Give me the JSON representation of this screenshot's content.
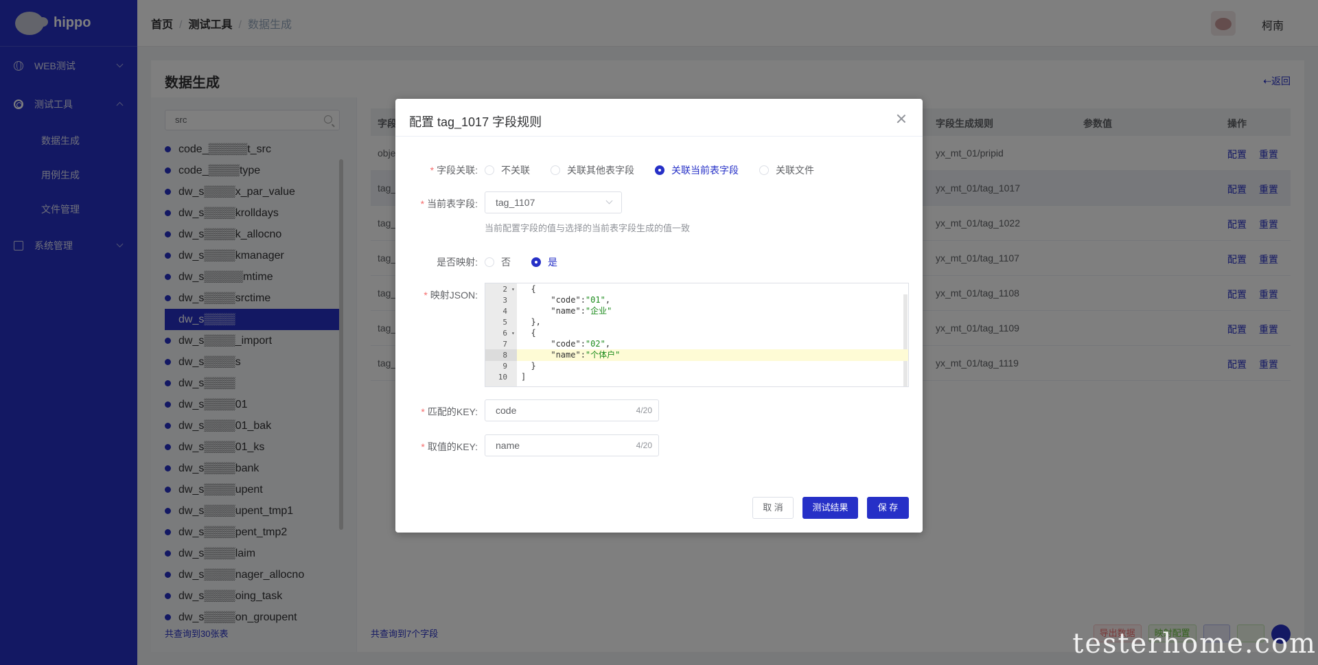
{
  "app": {
    "name": "hippo"
  },
  "sidebar": {
    "items": [
      {
        "label": "WEB测试"
      },
      {
        "label": "测试工具"
      },
      {
        "label": "系统管理"
      }
    ],
    "subitems": [
      {
        "label": "数据生成"
      },
      {
        "label": "用例生成"
      },
      {
        "label": "文件管理"
      }
    ]
  },
  "header": {
    "breadcrumb": [
      "首页",
      "测试工具",
      "数据生成"
    ],
    "username": "柯南"
  },
  "page": {
    "title": "数据生成",
    "back": "⇠返回"
  },
  "left": {
    "search_value": "src",
    "tables": [
      "code_▒▒▒▒▒t_src",
      "code_▒▒▒▒type",
      "dw_s▒▒▒▒x_par_value",
      "dw_s▒▒▒▒krolldays",
      "dw_s▒▒▒▒k_allocno",
      "dw_s▒▒▒▒kmanager",
      "dw_s▒▒▒▒▒mtime",
      "dw_s▒▒▒▒srctime",
      "dw_s▒▒▒▒",
      "dw_s▒▒▒▒_import",
      "dw_s▒▒▒▒s",
      "dw_s▒▒▒▒",
      "dw_s▒▒▒▒01",
      "dw_s▒▒▒▒01_bak",
      "dw_s▒▒▒▒01_ks",
      "dw_s▒▒▒▒bank",
      "dw_s▒▒▒▒upent",
      "dw_s▒▒▒▒upent_tmp1",
      "dw_s▒▒▒▒pent_tmp2",
      "dw_s▒▒▒▒laim",
      "dw_s▒▒▒▒nager_allocno",
      "dw_s▒▒▒▒oing_task",
      "dw_s▒▒▒▒on_groupent"
    ],
    "count": "共查询到30张表"
  },
  "right": {
    "columns": [
      "字段",
      "字段生成规则",
      "参数值",
      "操作"
    ],
    "rows": [
      {
        "field": "obje",
        "rule": "yx_mt_01/pripid"
      },
      {
        "field": "tag_",
        "rule": "yx_mt_01/tag_1017"
      },
      {
        "field": "tag_",
        "rule": "yx_mt_01/tag_1022"
      },
      {
        "field": "tag_",
        "rule": "yx_mt_01/tag_1107"
      },
      {
        "field": "tag_",
        "rule": "yx_mt_01/tag_1108"
      },
      {
        "field": "tag_",
        "rule": "yx_mt_01/tag_1109"
      },
      {
        "field": "tag_",
        "rule": "yx_mt_01/tag_1119"
      }
    ],
    "op_config": "配置",
    "op_reset": "重置",
    "count": "共查询到7个字段",
    "buttons": {
      "export": "导出数据",
      "map": "映射配置"
    }
  },
  "dialog": {
    "title": "配置 tag_1017 字段规则",
    "relation_label": "字段关联:",
    "relation_options": [
      "不关联",
      "关联其他表字段",
      "关联当前表字段",
      "关联文件"
    ],
    "current_field_label": "当前表字段:",
    "current_field_value": "tag_1107",
    "hint": "当前配置字段的值与选择的当前表字段生成的值一致",
    "mapping_label": "是否映射:",
    "mapping_options": [
      "否",
      "是"
    ],
    "json_label": "映射JSON:",
    "json_lines": [
      {
        "n": "2",
        "text": "  {"
      },
      {
        "n": "3",
        "text": "      \"code\":\"01\","
      },
      {
        "n": "4",
        "text": "      \"name\":\"企业\""
      },
      {
        "n": "5",
        "text": "  },"
      },
      {
        "n": "6",
        "text": "  {"
      },
      {
        "n": "7",
        "text": "      \"code\":\"02\","
      },
      {
        "n": "8",
        "text": "      \"name\":\"个体户\""
      },
      {
        "n": "9",
        "text": "  }"
      },
      {
        "n": "10",
        "text": "]"
      }
    ],
    "match_key_label": "匹配的KEY:",
    "match_key_value": "code",
    "match_key_count": "4/20",
    "value_key_label": "取值的KEY:",
    "value_key_value": "name",
    "value_key_count": "4/20",
    "cancel": "取 消",
    "test": "测试结果",
    "save": "保 存"
  },
  "watermark": "testerhome.com"
}
